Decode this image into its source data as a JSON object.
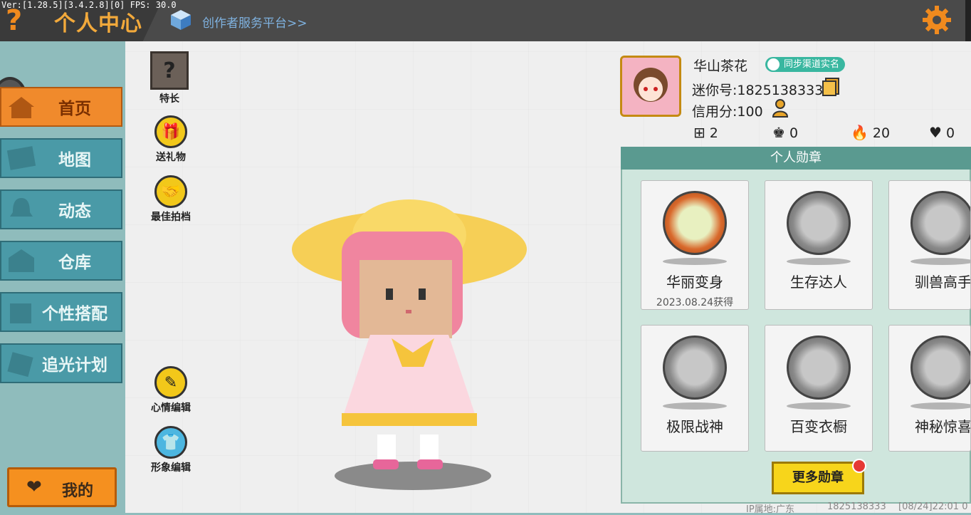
{
  "topbar": {
    "version_text": "Ver:[1.28.5][3.4.2.8][0] FPS: 30.0",
    "title": "个人中心",
    "creator_link": "创作者服务平台>>"
  },
  "sidebar": {
    "items": [
      {
        "label": "首页",
        "icon": "house-icon",
        "active": true
      },
      {
        "label": "地图",
        "icon": "map-icon",
        "active": false
      },
      {
        "label": "动态",
        "icon": "bell-icon",
        "active": false
      },
      {
        "label": "仓库",
        "icon": "warehouse-icon",
        "active": false
      },
      {
        "label": "个性搭配",
        "icon": "outfit-icon",
        "active": false
      },
      {
        "label": "追光计划",
        "icon": "spotlight-icon",
        "active": false
      }
    ],
    "mine_label": "我的"
  },
  "actions": {
    "skill_label": "特长",
    "gift_label": "送礼物",
    "best_partner_label": "最佳拍档",
    "mood_edit_label": "心情编辑",
    "avatar_edit_label": "形象编辑"
  },
  "profile": {
    "nickname": "华山茶花",
    "sync_badge": "同步渠道实名",
    "mini_id": "迷你号:1825138333",
    "credit": "信用分:100",
    "stats": {
      "friends": "2",
      "fans": "0",
      "popularity": "20",
      "likes": "0"
    }
  },
  "medals": {
    "title": "个人勋章",
    "items": [
      {
        "name": "华丽变身",
        "date": "2023.08.24获得",
        "unlocked": true
      },
      {
        "name": "生存达人",
        "date": "",
        "unlocked": false
      },
      {
        "name": "驯兽高手",
        "date": "",
        "unlocked": false
      },
      {
        "name": "极限战神",
        "date": "",
        "unlocked": false
      },
      {
        "name": "百变衣橱",
        "date": "",
        "unlocked": false
      },
      {
        "name": "神秘惊喜",
        "date": "",
        "unlocked": false
      }
    ],
    "more_label": "更多勋章"
  },
  "footer": {
    "ip_location": "IP属地:广东",
    "uid": "1825138333",
    "timestamp": "[08/24]22:01 0"
  },
  "colors": {
    "accent_orange": "#f08a2c",
    "nav_teal": "#4a9aa7",
    "medal_header": "#5a9a90",
    "button_yellow": "#f7d51b"
  }
}
